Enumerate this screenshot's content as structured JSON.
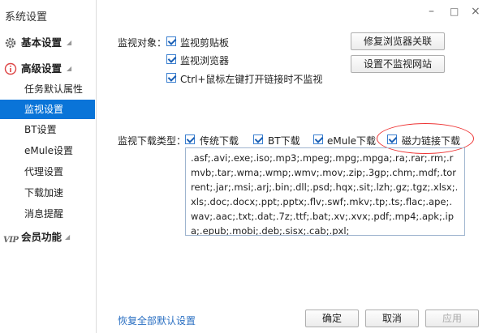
{
  "window": {
    "title": "系统设置",
    "controls": [
      "–",
      "□",
      "×"
    ]
  },
  "sidebar": {
    "sections": [
      {
        "label": "基本设置",
        "icon": "gear-icon"
      },
      {
        "label": "高级设置",
        "icon": "info-icon"
      },
      {
        "label": "会员功能",
        "icon": "vip-icon",
        "badge": "VIP"
      }
    ],
    "items": [
      "任务默认属性",
      "监视设置",
      "BT设置",
      "eMule设置",
      "代理设置",
      "下载加速",
      "消息提醒"
    ],
    "active_index": 1
  },
  "monitor": {
    "label": "监视对象：",
    "options": [
      "监视剪贴板",
      "监视浏览器",
      "Ctrl+鼠标左键打开链接时不监视"
    ],
    "buttons": [
      "修复浏览器关联",
      "设置不监视网站"
    ]
  },
  "download_types": {
    "label": "监视下载类型：",
    "options": [
      "传统下载",
      "BT下载",
      "eMule下载",
      "磁力链接下载"
    ],
    "extensions": ".asf;.avi;.exe;.iso;.mp3;.mpeg;.mpg;.mpga;.ra;.rar;.rm;.rmvb;.tar;.wma;.wmp;.wmv;.mov;.zip;.3gp;.chm;.mdf;.torrent;.jar;.msi;.arj;.bin;.dll;.psd;.hqx;.sit;.lzh;.gz;.tgz;.xlsx;.xls;.doc;.docx;.ppt;.pptx;.flv;.swf;.mkv;.tp;.ts;.flac;.ape;.wav;.aac;.txt;.dat;.7z;.ttf;.bat;.xv;.xvx;.pdf;.mp4;.apk;.ipa;.epub;.mobi;.deb;.sisx;.cab;.pxl;"
  },
  "footer": {
    "restore_link": "恢复全部默认设置",
    "ok": "确定",
    "cancel": "取消",
    "apply": "应用"
  },
  "colors": {
    "accent": "#0a74d8",
    "highlight_circle": "#e33333",
    "link": "#2a6fc2"
  }
}
